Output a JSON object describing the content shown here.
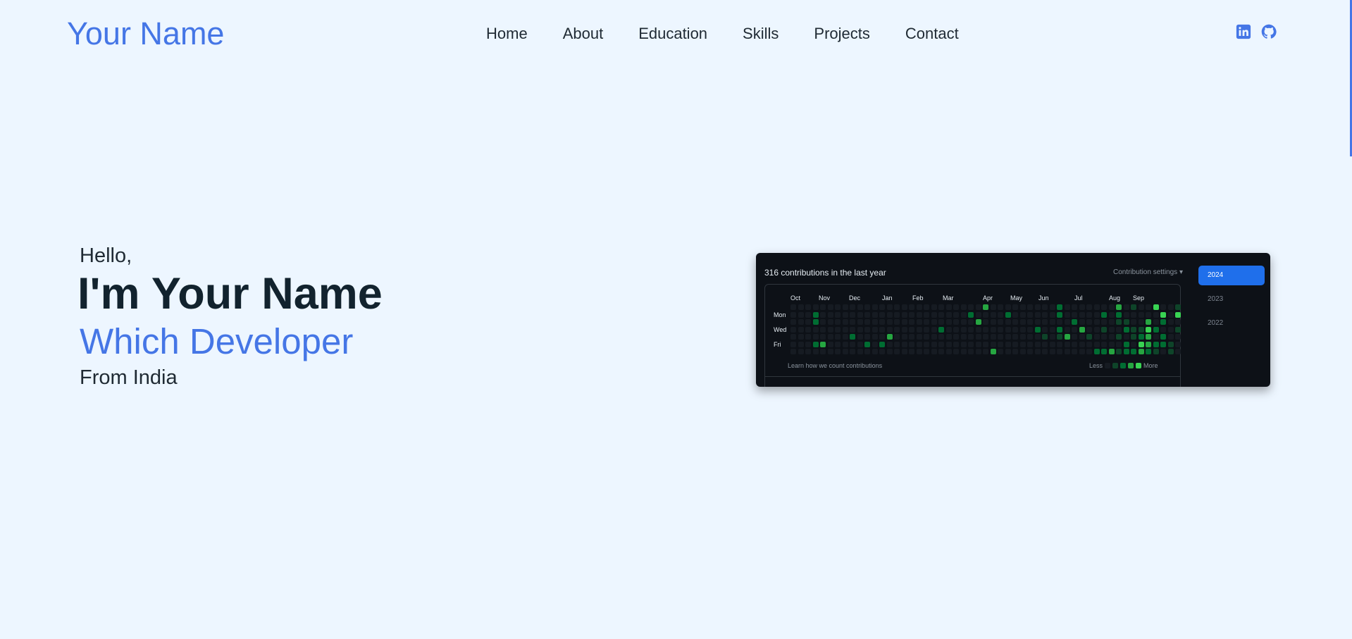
{
  "header": {
    "brand": "Your Name",
    "nav": [
      "Home",
      "About",
      "Education",
      "Skills",
      "Projects",
      "Contact"
    ],
    "social_icons": [
      "linkedin-icon",
      "github-icon"
    ]
  },
  "hero": {
    "greeting": "Hello,",
    "name": "I'm Your Name",
    "role": "Which Developer",
    "location": "From India"
  },
  "contributions": {
    "title": "316 contributions in the last year",
    "settings_label": "Contribution settings ▾",
    "months": [
      "Oct",
      "Nov",
      "Dec",
      "Jan",
      "Feb",
      "Mar",
      "Apr",
      "May",
      "Jun",
      "Jul",
      "Aug",
      "Sep"
    ],
    "days": [
      "Mon",
      "Wed",
      "Fri"
    ],
    "learn_link": "Learn how we count contributions",
    "legend_less": "Less",
    "legend_more": "More",
    "years": [
      "2024",
      "2023",
      "2022"
    ],
    "active_year": "2024"
  },
  "colors": {
    "accent": "#4576e6",
    "background": "#edf6ff",
    "card_background": "#0d1117",
    "year_active": "#1f6feb"
  }
}
